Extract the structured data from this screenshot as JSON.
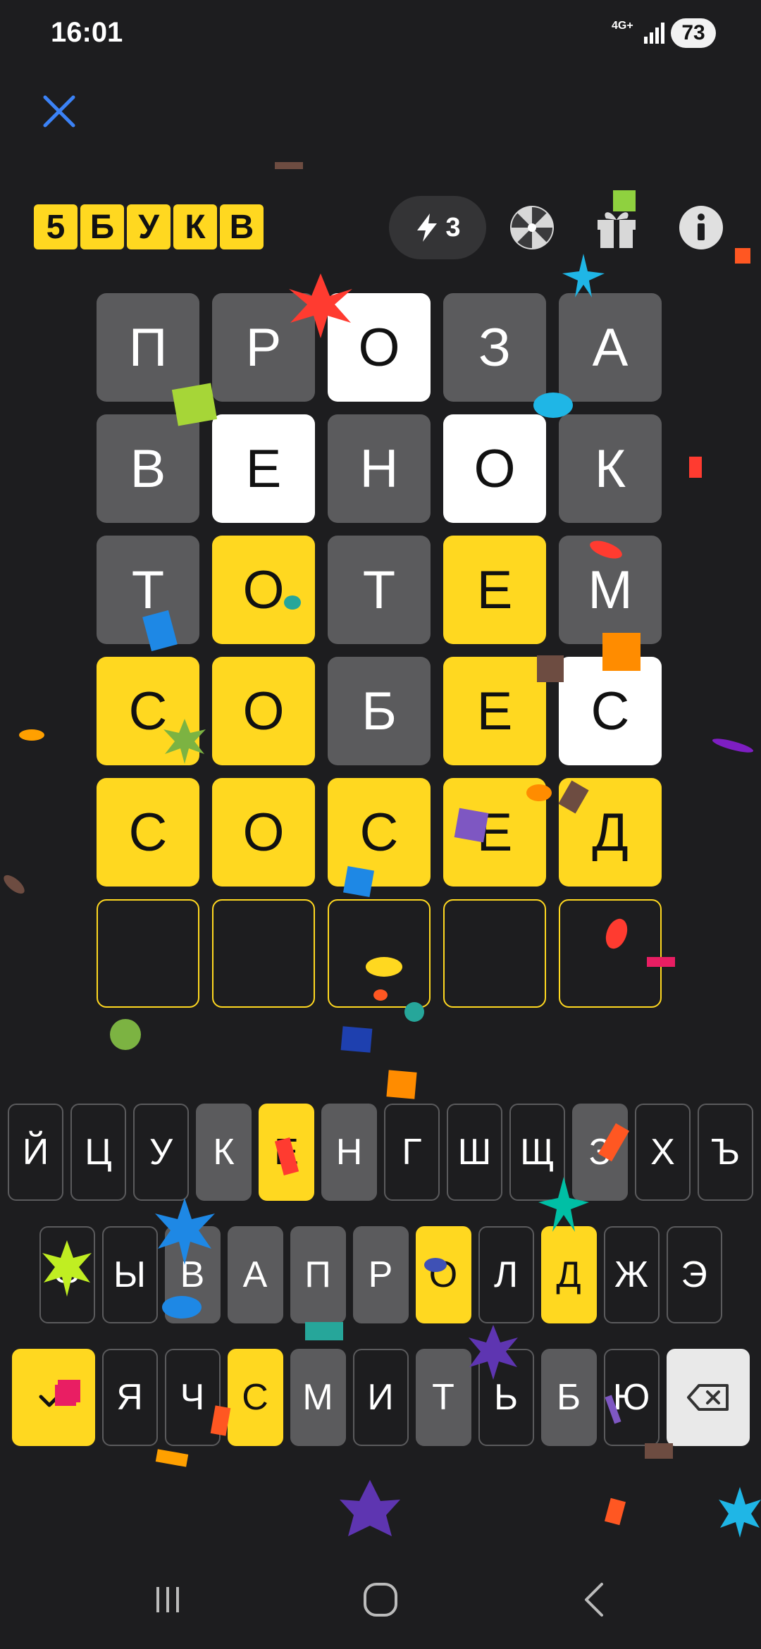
{
  "status_bar": {
    "time": "16:01",
    "network": "4G+",
    "battery": "73"
  },
  "header": {
    "logo_letters": [
      "5",
      "Б",
      "У",
      "К",
      "В"
    ],
    "energy_count": "3"
  },
  "board": [
    [
      {
        "l": "П",
        "s": "gray"
      },
      {
        "l": "Р",
        "s": "gray"
      },
      {
        "l": "О",
        "s": "white"
      },
      {
        "l": "З",
        "s": "gray"
      },
      {
        "l": "А",
        "s": "gray"
      }
    ],
    [
      {
        "l": "В",
        "s": "gray"
      },
      {
        "l": "Е",
        "s": "white"
      },
      {
        "l": "Н",
        "s": "gray"
      },
      {
        "l": "О",
        "s": "white"
      },
      {
        "l": "К",
        "s": "gray"
      }
    ],
    [
      {
        "l": "Т",
        "s": "gray"
      },
      {
        "l": "О",
        "s": "yellow"
      },
      {
        "l": "Т",
        "s": "gray"
      },
      {
        "l": "Е",
        "s": "yellow"
      },
      {
        "l": "М",
        "s": "gray"
      }
    ],
    [
      {
        "l": "С",
        "s": "yellow"
      },
      {
        "l": "О",
        "s": "yellow"
      },
      {
        "l": "Б",
        "s": "gray"
      },
      {
        "l": "Е",
        "s": "yellow"
      },
      {
        "l": "С",
        "s": "white"
      }
    ],
    [
      {
        "l": "С",
        "s": "yellow"
      },
      {
        "l": "О",
        "s": "yellow"
      },
      {
        "l": "С",
        "s": "yellow"
      },
      {
        "l": "Е",
        "s": "yellow"
      },
      {
        "l": "Д",
        "s": "yellow"
      }
    ],
    [
      {
        "l": "",
        "s": "empty"
      },
      {
        "l": "",
        "s": "empty"
      },
      {
        "l": "",
        "s": "empty"
      },
      {
        "l": "",
        "s": "empty"
      },
      {
        "l": "",
        "s": "empty"
      }
    ]
  ],
  "keyboard": {
    "row1": [
      {
        "k": "Й",
        "s": "dark"
      },
      {
        "k": "Ц",
        "s": "dark"
      },
      {
        "k": "У",
        "s": "dark"
      },
      {
        "k": "К",
        "s": "gray"
      },
      {
        "k": "Е",
        "s": "yellow"
      },
      {
        "k": "Н",
        "s": "gray"
      },
      {
        "k": "Г",
        "s": "dark"
      },
      {
        "k": "Ш",
        "s": "dark"
      },
      {
        "k": "Щ",
        "s": "dark"
      },
      {
        "k": "З",
        "s": "gray"
      },
      {
        "k": "Х",
        "s": "dark"
      },
      {
        "k": "Ъ",
        "s": "dark"
      }
    ],
    "row2": [
      {
        "k": "Ф",
        "s": "dark"
      },
      {
        "k": "Ы",
        "s": "dark"
      },
      {
        "k": "В",
        "s": "gray"
      },
      {
        "k": "А",
        "s": "gray"
      },
      {
        "k": "П",
        "s": "gray"
      },
      {
        "k": "Р",
        "s": "gray"
      },
      {
        "k": "О",
        "s": "yellow"
      },
      {
        "k": "Л",
        "s": "dark"
      },
      {
        "k": "Д",
        "s": "yellow"
      },
      {
        "k": "Ж",
        "s": "dark"
      },
      {
        "k": "Э",
        "s": "dark"
      }
    ],
    "row3": [
      {
        "k": "Я",
        "s": "dark"
      },
      {
        "k": "Ч",
        "s": "dark"
      },
      {
        "k": "С",
        "s": "yellow"
      },
      {
        "k": "М",
        "s": "gray"
      },
      {
        "k": "И",
        "s": "dark"
      },
      {
        "k": "Т",
        "s": "gray"
      },
      {
        "k": "Ь",
        "s": "dark"
      },
      {
        "k": "Б",
        "s": "gray"
      },
      {
        "k": "Ю",
        "s": "dark"
      }
    ]
  },
  "colors": {
    "background": "#1d1d1f",
    "absent": "#5b5b5d",
    "present": "#ffffff",
    "correct": "#ffd820",
    "accent_close": "#3b82f6"
  }
}
